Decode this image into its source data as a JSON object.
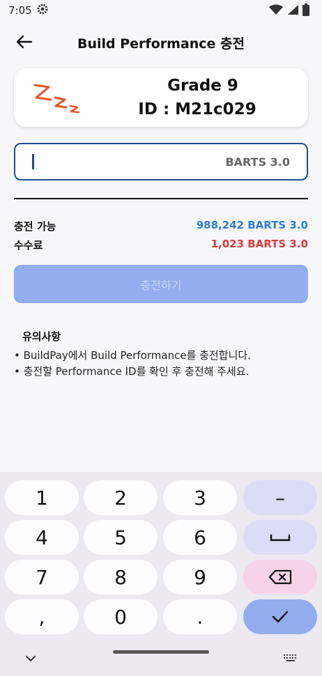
{
  "status_bar": {
    "time": "7:05"
  },
  "header": {
    "title": "Build Performance 충전"
  },
  "profile": {
    "grade": "Grade 9",
    "id_label": "ID : M21c029"
  },
  "amount_input": {
    "value": "",
    "unit": "BARTS 3.0"
  },
  "summary": {
    "available_label": "충전 가능",
    "available_value": "988,242 BARTS 3.0",
    "fee_label": "수수료",
    "fee_value": "1,023 BARTS 3.0",
    "colors": {
      "available": "#2b7fd6",
      "fee": "#d93a3a"
    }
  },
  "charge_button": {
    "label": "충전하기"
  },
  "notice": {
    "title": "유의사항",
    "items": [
      "• BuildPay에서 Build Performance를 충전합니다.",
      "• 충전할 Performance ID를 확인 후 충전해 주세요."
    ]
  },
  "keypad": {
    "rows": [
      [
        "1",
        "2",
        "3",
        "–"
      ],
      [
        "4",
        "5",
        "6",
        "space-icon"
      ],
      [
        "7",
        "8",
        "9",
        "backspace-icon"
      ],
      [
        ",",
        "0",
        ".",
        "check-icon"
      ]
    ],
    "colors": {
      "function_key": "#dcdcf7",
      "delete_key": "#f6d3e8",
      "done_key": "#93acf0"
    }
  }
}
